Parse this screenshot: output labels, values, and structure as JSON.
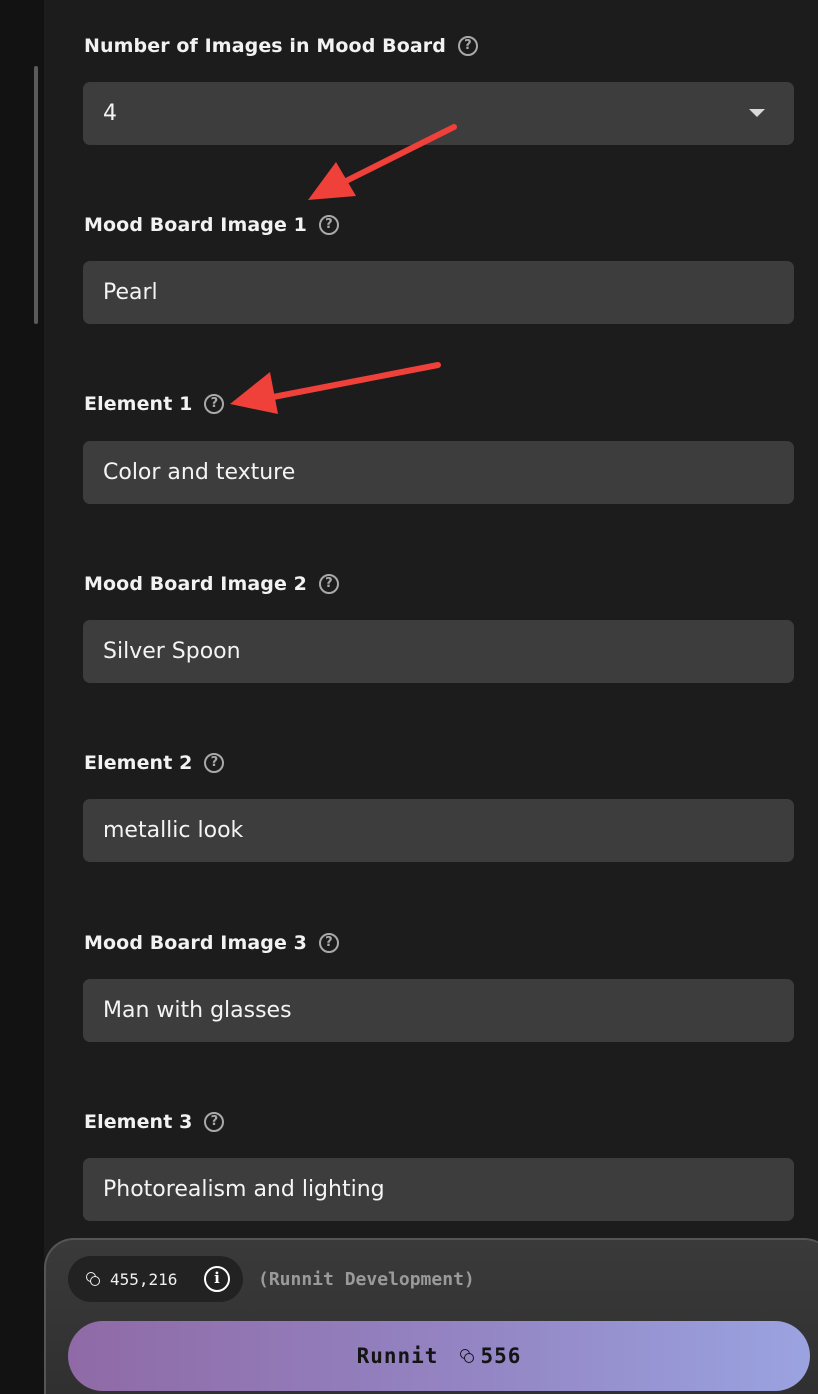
{
  "form": {
    "num_images": {
      "label": "Number of Images in Mood Board",
      "help_icon": "question-circle-icon",
      "value": "4"
    },
    "fields": [
      {
        "label": "Mood Board Image 1",
        "value": "Pearl"
      },
      {
        "label": "Element 1",
        "value": "Color and texture"
      },
      {
        "label": "Mood Board Image 2",
        "value": "Silver Spoon"
      },
      {
        "label": "Element 2",
        "value": "metallic look"
      },
      {
        "label": "Mood Board Image 3",
        "value": "Man with glasses"
      },
      {
        "label": "Element 3",
        "value": "Photorealism and lighting"
      }
    ],
    "help_glyph": "?"
  },
  "footer": {
    "credits": "455,216",
    "info_glyph": "i",
    "environment": "(Runnit Development)",
    "run_label": "Runnit",
    "run_cost": "556"
  },
  "colors": {
    "background": "#1c1c1c",
    "input": "#3d3d3d",
    "annotation_arrow": "#f0403a",
    "button_gradient_start": "#8f6aa6",
    "button_gradient_end": "#9aa3e0"
  }
}
